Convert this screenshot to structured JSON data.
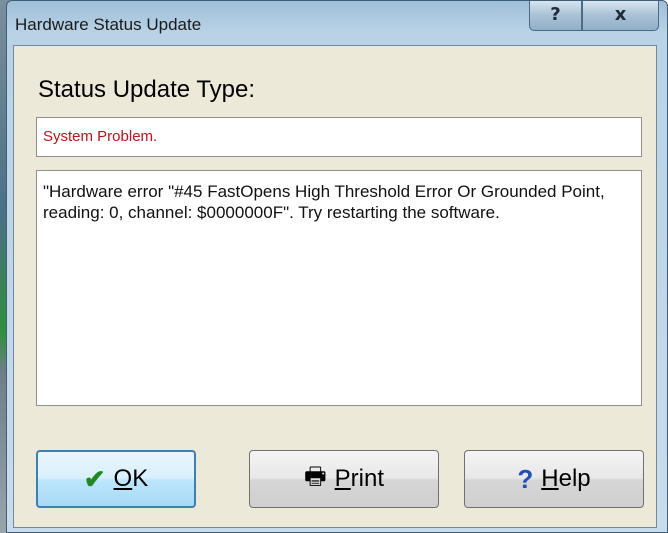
{
  "window": {
    "title": "Hardware Status Update",
    "help_button": "?",
    "close_button": "x"
  },
  "status": {
    "heading": "Status Update Type:",
    "type_value": "System Problem.",
    "message": "\"Hardware error \"#45 FastOpens High Threshold Error Or Grounded Point, reading: 0, channel: $0000000F\".  Try restarting the software."
  },
  "buttons": {
    "ok": {
      "icon": "checkmark-icon",
      "accel": "O",
      "rest": "K"
    },
    "print": {
      "icon": "printer-icon",
      "accel": "P",
      "rest": "rint"
    },
    "help": {
      "icon": "question-mark-icon",
      "accel": "H",
      "rest": "elp"
    }
  },
  "colors": {
    "status_type_text": "#c0141a",
    "ok_check": "#1f8a1f",
    "help_question": "#1f4fb8"
  }
}
